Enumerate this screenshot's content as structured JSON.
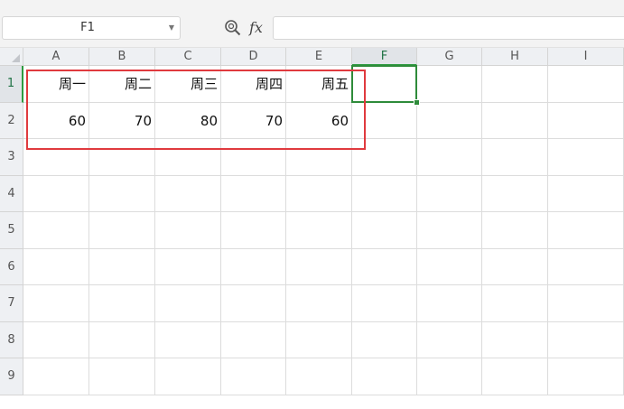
{
  "formula_bar": {
    "name_box_value": "F1",
    "fx_label": "fx",
    "formula_value": ""
  },
  "columns": [
    "A",
    "B",
    "C",
    "D",
    "E",
    "F",
    "G",
    "H",
    "I"
  ],
  "rows": [
    "1",
    "2",
    "3",
    "4",
    "5",
    "6",
    "7",
    "8",
    "9"
  ],
  "cells": [
    [
      "周一",
      "周二",
      "周三",
      "周四",
      "周五"
    ],
    [
      "60",
      "70",
      "80",
      "70",
      "60"
    ]
  ],
  "active_cell": {
    "column": "F",
    "row": "1"
  },
  "colors": {
    "selection": "#2e8b3a",
    "annotation_box": "#e03a3e",
    "header_bg": "#eef0f3",
    "gridline": "#dcdcdc"
  }
}
